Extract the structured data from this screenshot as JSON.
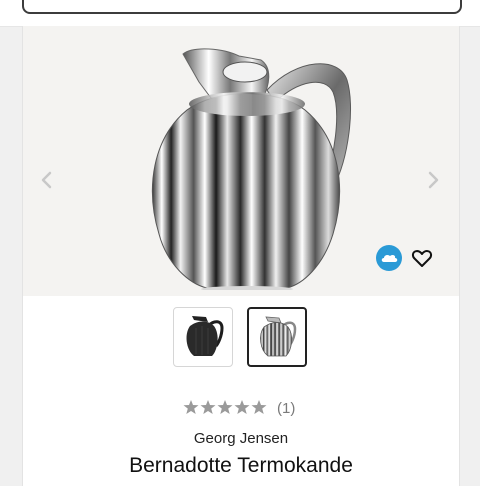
{
  "product": {
    "brand": "Georg Jensen",
    "name": "Bernadotte Termokande",
    "rating_count": "(1)",
    "rating_value": 0,
    "rating_max": 5
  },
  "gallery": {
    "image_count": 2,
    "selected_index": 2
  },
  "icons": {
    "prev": "chevron-left-icon",
    "next": "chevron-right-icon",
    "badge": "cloud-badge-icon",
    "favorite": "heart-outline-icon",
    "star": "star-icon"
  },
  "colors": {
    "badge": "#2a9ad6",
    "star_empty": "#9a9a9a",
    "text": "#111111",
    "muted": "#7a7a7a"
  }
}
